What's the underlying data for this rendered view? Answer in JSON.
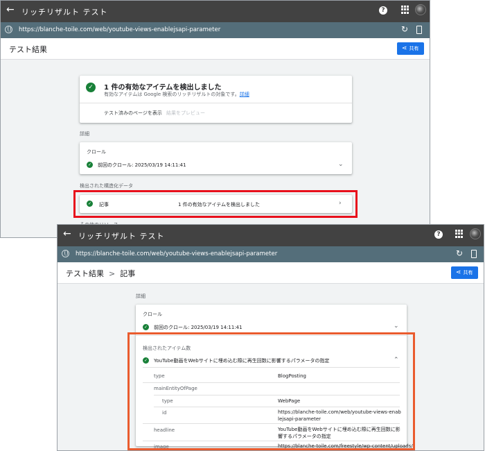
{
  "app": {
    "title": "リッチリザルト テスト"
  },
  "url": "https://blanche-toile.com/web/youtube-views-enablejsapi-parameter",
  "share_label": "共有",
  "shot1": {
    "crumb": "テスト結果",
    "summary": {
      "title": "1 件の有効なアイテムを検出しました",
      "desc": "有効なアイテムは Google 検索のリッチリザルトの対象です。",
      "detail_link": "詳細",
      "view_tested": "テスト済みのページを表示",
      "preview": "結果をプレビュー"
    },
    "details_label": "詳細",
    "crawl": {
      "label": "クロール",
      "value": "前回のクロール: 2025/03/19 14:11:41"
    },
    "structured_label": "検出された構造化データ",
    "article": {
      "name": "記事",
      "status": "1 件の有効なアイテムを検出しました"
    },
    "other_resources_label": "その他のリソース"
  },
  "shot2": {
    "crumb_root": "テスト結果",
    "crumb_sep": ">",
    "crumb_current": "記事",
    "details_label": "詳細",
    "crawl": {
      "label": "クロール",
      "value": "前回のクロール: 2025/03/19 14:11:41"
    },
    "detected_label": "検出されたアイテム数",
    "item_title": "YouTube動画をWebサイトに埋め込む際に再生回数に影響するパラメータの指定",
    "props": [
      {
        "key": "type",
        "value": "BlogPosting"
      },
      {
        "key": "mainEntityOfPage",
        "value": ""
      },
      {
        "key": "type",
        "value": "WebPage"
      },
      {
        "key": "id",
        "value": "https://blanche-toile.com/web/youtube-views-enablejsapi-parameter"
      },
      {
        "key": "headline",
        "value": "YouTube動画をWebサイトに埋め込む際に再生回数に影響するパラメータの指定"
      },
      {
        "key": "image",
        "value": "https://blanche-toile.com/freestyle/wp-content/uploads/"
      }
    ]
  },
  "colors": {
    "appbar": "#424242",
    "urlbar": "#546e7a",
    "success": "#188038",
    "share_button": "#1a73e8",
    "highlight_red": "#e8101c",
    "highlight_orange": "#ea5b2e"
  },
  "icons": [
    "back-arrow-icon",
    "help-icon",
    "apps-grid-icon",
    "globe-icon",
    "reload-icon",
    "mobile-device-icon",
    "share-icon",
    "check-circle-icon",
    "chevron-down-icon",
    "chevron-right-icon",
    "chevron-up-icon"
  ]
}
